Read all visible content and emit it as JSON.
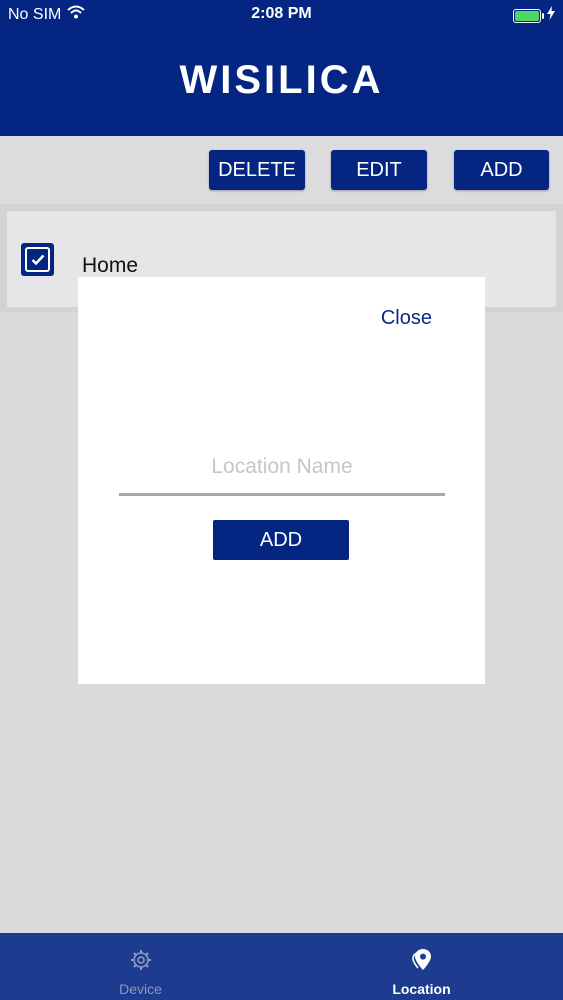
{
  "status_bar": {
    "carrier": "No SIM",
    "time": "2:08 PM"
  },
  "header": {
    "logo_text": "WISILICA"
  },
  "toolbar": {
    "delete_label": "DELETE",
    "edit_label": "EDIT",
    "add_label": "ADD"
  },
  "locations": [
    {
      "label": "Home",
      "checked": true
    }
  ],
  "modal": {
    "close_label": "Close",
    "input_placeholder": "Location Name",
    "input_value": "",
    "add_label": "ADD"
  },
  "tabbar": {
    "tabs": [
      {
        "label": "Device",
        "icon": "gear-icon",
        "active": false
      },
      {
        "label": "Location",
        "icon": "location-pin-icon",
        "active": true
      }
    ]
  },
  "colors": {
    "brand_blue": "#052583",
    "tabbar_blue": "#1d3c8f",
    "battery_green": "#4cd964"
  }
}
